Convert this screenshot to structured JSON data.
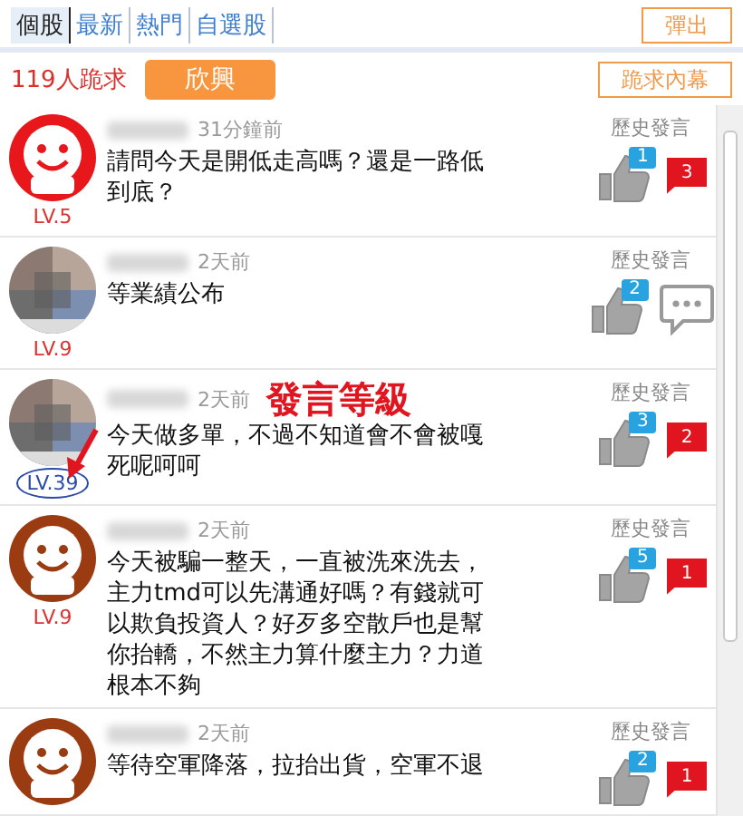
{
  "tabs": [
    {
      "label": "個股",
      "selected": true
    },
    {
      "label": "最新",
      "selected": false
    },
    {
      "label": "熱門",
      "selected": false
    },
    {
      "label": "自選股",
      "selected": false
    }
  ],
  "popout_button": "彈出",
  "header": {
    "count_text": "119人跪求",
    "stock_button": "欣興",
    "insider_button": "跪求內幕"
  },
  "posts": [
    {
      "avatar": {
        "kind": "smiley",
        "color": "#e8171b"
      },
      "level": "LV.5",
      "time": "31分鐘前",
      "text": "請問今天是開低走高嗎？還是一路低到底？",
      "history": "歷史發言",
      "likes": "1",
      "comments": {
        "kind": "count",
        "count": "3"
      }
    },
    {
      "level": "LV.9",
      "time": "2天前",
      "text": "等業績公布",
      "history": "歷史發言",
      "likes": "2",
      "comments": {
        "kind": "icon"
      }
    },
    {
      "level": "LV.39",
      "time": "2天前",
      "text": "今天做多單，不過不知道會不會被嘎死呢呵呵",
      "history": "歷史發言",
      "likes": "3",
      "comments": {
        "kind": "count",
        "count": "2"
      },
      "annotation": "發言等級"
    },
    {
      "avatar": {
        "kind": "smiley",
        "color": "#9a3b12"
      },
      "level": "LV.9",
      "time": "2天前",
      "text": "今天被騙一整天，一直被洗來洗去，主力tmd可以先溝通好嗎？有錢就可以欺負投資人？好歹多空散戶也是幫你抬轎，不然主力算什麼主力？力道根本不夠",
      "history": "歷史發言",
      "likes": "5",
      "comments": {
        "kind": "count",
        "count": "1"
      }
    },
    {
      "avatar": {
        "kind": "smiley",
        "color": "#9a3b12"
      },
      "time": "2天前",
      "text": "等待空軍降落，拉抬出貨，空軍不退",
      "history": "歷史發言",
      "likes": "2",
      "comments": {
        "kind": "count",
        "count": "1"
      }
    }
  ]
}
